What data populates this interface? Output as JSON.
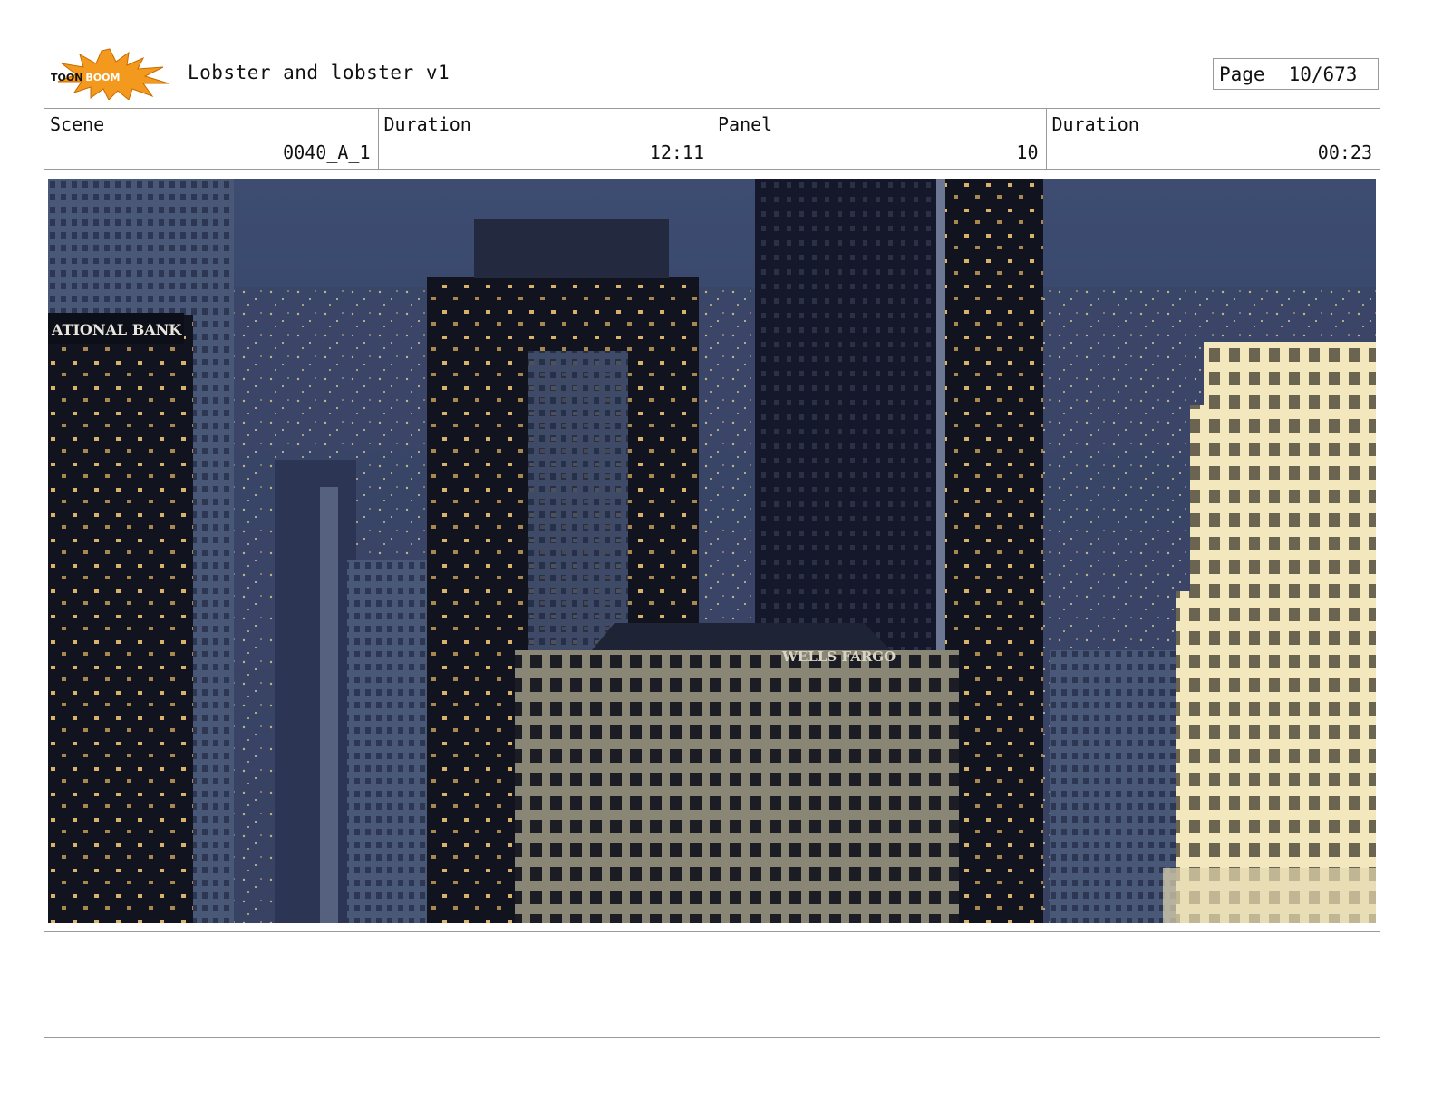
{
  "header": {
    "logo_text": "TOON BOOM",
    "title": "Lobster and lobster v1",
    "page_label": "Page",
    "page_value": "10/673"
  },
  "info": {
    "scene_label": "Scene",
    "scene_value": "0040_A_1",
    "scene_duration_label": "Duration",
    "scene_duration_value": "12:11",
    "panel_label": "Panel",
    "panel_value": "10",
    "panel_duration_label": "Duration",
    "panel_duration_value": "00:23"
  },
  "image": {
    "sign_left": "ATIONAL BANK",
    "sign_center": "WELLS FARGO"
  },
  "colors": {
    "border": "#9a9a9a",
    "logo_orange": "#f39a1e",
    "sky": "#3a4a6e"
  },
  "notes": ""
}
